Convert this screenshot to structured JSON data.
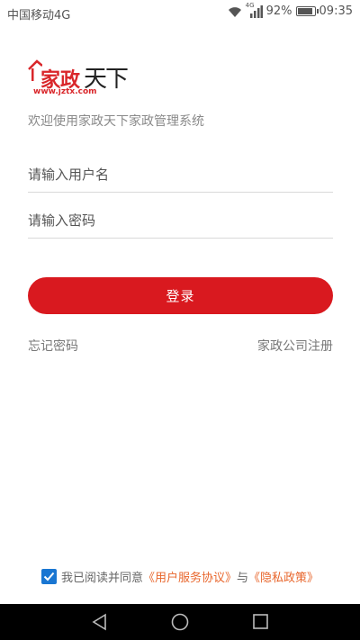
{
  "status_bar": {
    "carrier": "中国移动4G",
    "network_tag": "4G",
    "battery": "92%",
    "battery_level": 0.92,
    "time": "09:35"
  },
  "logo": {
    "name": "家政",
    "tianxia": "天下",
    "url": "www.jztx.com",
    "accent_color": "#d9262a"
  },
  "welcome": "欢迎使用家政天下家政管理系统",
  "form": {
    "username_placeholder": "请输入用户名",
    "password_placeholder": "请输入密码",
    "login_label": "登录",
    "login_color": "#d9191f"
  },
  "links": {
    "forgot_password": "忘记密码",
    "company_register": "家政公司注册"
  },
  "agreement": {
    "checked": true,
    "prefix": "我已阅读并同意",
    "service_link": "《用户服务协议》",
    "and": "与",
    "privacy_link": "《隐私政策》",
    "link_color": "#e8662c"
  },
  "nav": {
    "back_icon": "back-triangle-icon",
    "home_icon": "home-circle-icon",
    "recents_icon": "recents-square-icon"
  }
}
